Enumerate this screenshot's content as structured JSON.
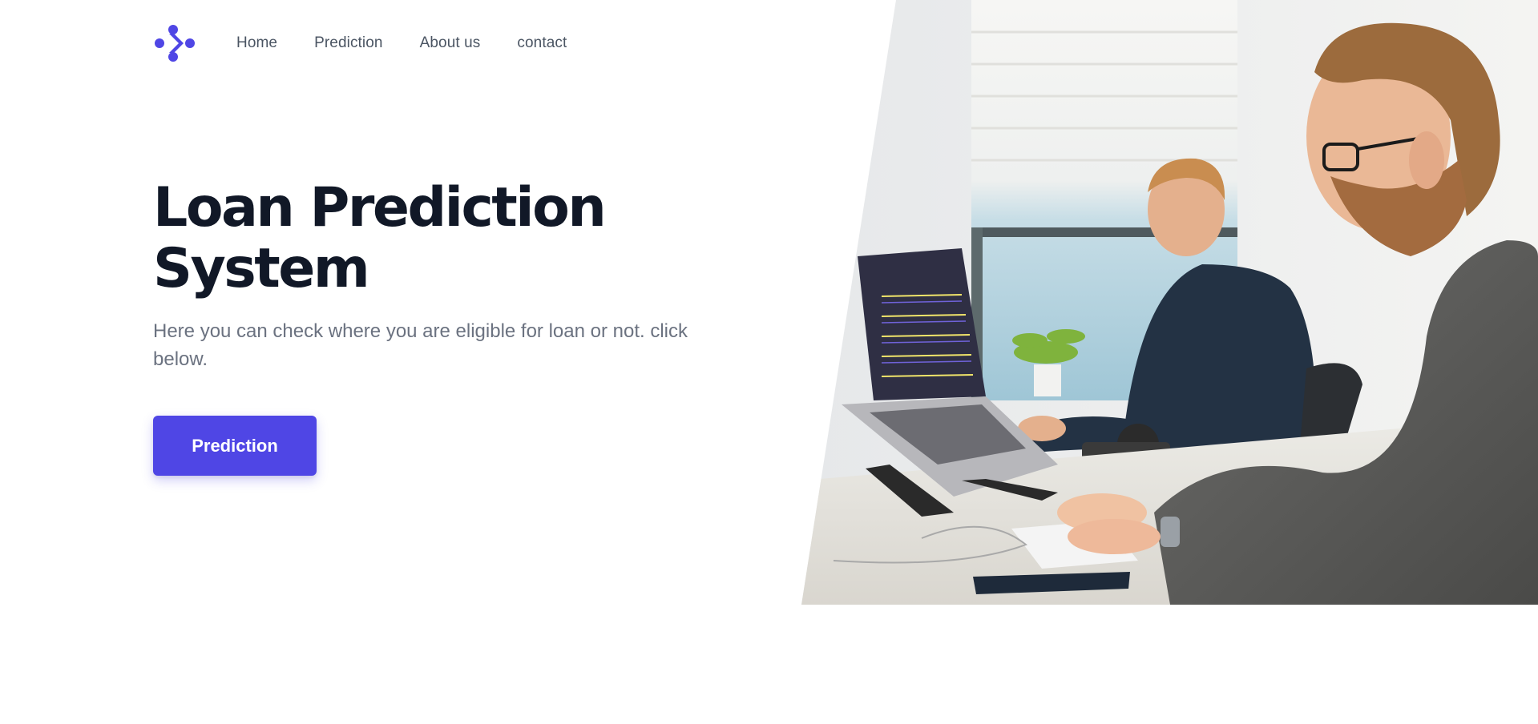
{
  "brand": {
    "logo_name": "brand-logo",
    "accent_color": "#4f46e5"
  },
  "nav": {
    "items": [
      {
        "label": "Home"
      },
      {
        "label": "Prediction"
      },
      {
        "label": "About us"
      },
      {
        "label": "contact"
      }
    ]
  },
  "hero": {
    "title_line1": "Loan Prediction",
    "title_line2": "System",
    "description": "Here you can check where you are eligible for loan or not. click below.",
    "cta_label": "Prediction"
  },
  "image": {
    "subject": "office-photo-two-men-working-on-computers"
  },
  "colors": {
    "title": "#111827",
    "body_text": "#6b7280",
    "nav_text": "#4b5563",
    "button_bg": "#4f46e5",
    "button_text": "#ffffff"
  }
}
